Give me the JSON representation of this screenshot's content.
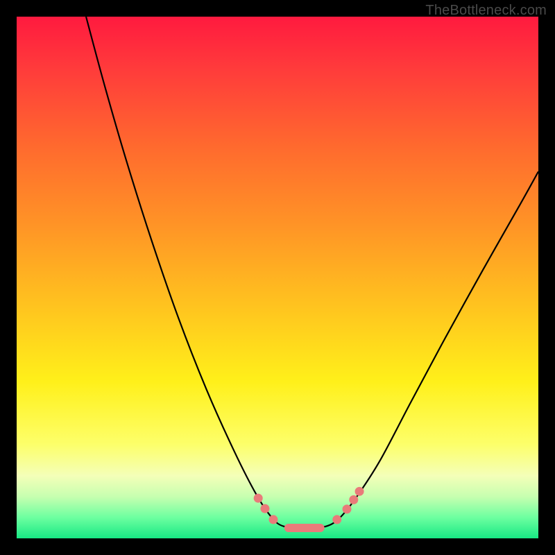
{
  "watermark": {
    "text": "TheBottleneck.com"
  },
  "colors": {
    "background": "#000000",
    "curve_stroke": "#000000",
    "marker_fill": "#e97b7a",
    "dead_zone_stroke": "#e97b7a",
    "gradient_top": "#ff1a3f",
    "gradient_bottom": "#17e884"
  },
  "chart_data": {
    "type": "line",
    "title": "",
    "xlabel": "",
    "ylabel": "",
    "xlim": [
      0,
      100
    ],
    "ylim": [
      0,
      100
    ],
    "grid": false,
    "legend": false,
    "annotations": [
      "TheBottleneck.com"
    ],
    "note": "Axis values are percent-of-plot read from pixel positions; the chart has no numeric tick labels.",
    "series": [
      {
        "name": "bottleneck-curve",
        "points": [
          {
            "x": 13.3,
            "y": 100.0
          },
          {
            "x": 16.8,
            "y": 87.0
          },
          {
            "x": 21.0,
            "y": 72.5
          },
          {
            "x": 25.9,
            "y": 57.0
          },
          {
            "x": 31.1,
            "y": 42.0
          },
          {
            "x": 36.4,
            "y": 28.5
          },
          {
            "x": 41.8,
            "y": 16.5
          },
          {
            "x": 46.0,
            "y": 8.3
          },
          {
            "x": 48.9,
            "y": 4.0
          },
          {
            "x": 51.2,
            "y": 2.3
          },
          {
            "x": 55.3,
            "y": 2.0
          },
          {
            "x": 59.3,
            "y": 2.3
          },
          {
            "x": 62.0,
            "y": 4.0
          },
          {
            "x": 65.2,
            "y": 8.0
          },
          {
            "x": 69.7,
            "y": 15.0
          },
          {
            "x": 75.5,
            "y": 26.0
          },
          {
            "x": 82.2,
            "y": 38.5
          },
          {
            "x": 89.4,
            "y": 51.5
          },
          {
            "x": 96.5,
            "y": 64.0
          },
          {
            "x": 100.0,
            "y": 70.3
          }
        ]
      },
      {
        "name": "markers",
        "points": [
          {
            "x": 46.3,
            "y": 7.7
          },
          {
            "x": 47.6,
            "y": 5.7
          },
          {
            "x": 49.2,
            "y": 3.6
          },
          {
            "x": 61.4,
            "y": 3.6
          },
          {
            "x": 63.3,
            "y": 5.6
          },
          {
            "x": 64.6,
            "y": 7.4
          },
          {
            "x": 65.7,
            "y": 9.0
          }
        ]
      },
      {
        "name": "dead-zone-band",
        "y": 2.0,
        "x_start": 51.3,
        "x_end": 59.0,
        "thickness_pct": 1.6
      }
    ]
  }
}
